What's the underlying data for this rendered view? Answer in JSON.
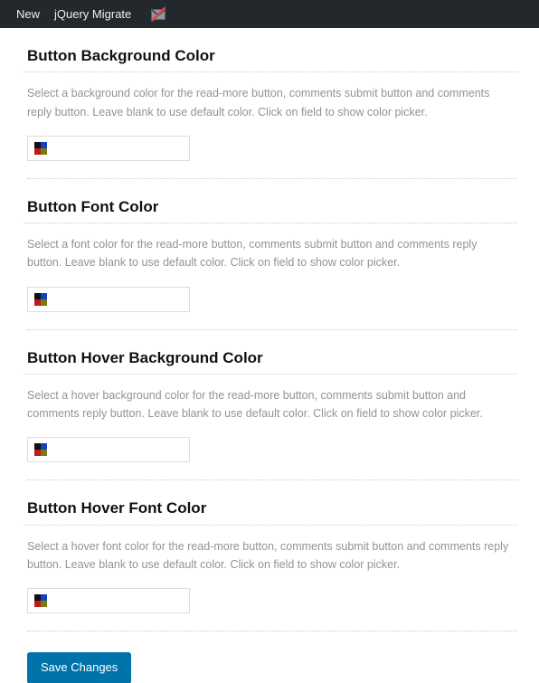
{
  "admin_bar": {
    "items": [
      {
        "label": "New",
        "name": "admin-bar-new"
      },
      {
        "label": "jQuery Migrate",
        "name": "admin-bar-jquery-migrate"
      }
    ],
    "icon": {
      "name": "mail-disabled-icon",
      "title": "",
      "envelope_color": "#8f959c",
      "strike_color": "#e04343"
    },
    "background": "#23282d",
    "text_color": "#eeeeee"
  },
  "sections": [
    {
      "title": "Button Background Color",
      "description": "Select a background color for the read-more button, comments submit button and comments reply button. Leave blank to use default color. Click on field to show color picker.",
      "field": {
        "name": "button-background-color-input",
        "value": "",
        "placeholder": "",
        "swatch": [
          "#111111",
          "#1a3fbd",
          "#c21a1a",
          "#7a7a12"
        ]
      }
    },
    {
      "title": "Button Font Color",
      "description": "Select a font color for the read-more button, comments submit button and comments reply button. Leave blank to use default color. Click on field to show color picker.",
      "field": {
        "name": "button-font-color-input",
        "value": "",
        "placeholder": "",
        "swatch": [
          "#111111",
          "#1a3fbd",
          "#c21a1a",
          "#7a7a12"
        ]
      }
    },
    {
      "title": "Button Hover Background Color",
      "description": "Select a hover background color for the read-more button, comments submit button and comments reply button. Leave blank to use default color. Click on field to show color picker.",
      "field": {
        "name": "button-hover-background-color-input",
        "value": "",
        "placeholder": "",
        "swatch": [
          "#111111",
          "#1a3fbd",
          "#c21a1a",
          "#7a7a12"
        ]
      }
    },
    {
      "title": "Button Hover Font Color",
      "description": "Select a hover font color for the read-more button, comments submit button and comments reply button. Leave blank to use default color. Click on field to show color picker.",
      "field": {
        "name": "button-hover-font-color-input",
        "value": "",
        "placeholder": "",
        "swatch": [
          "#111111",
          "#1a3fbd",
          "#c21a1a",
          "#7a7a12"
        ]
      }
    }
  ],
  "submit": {
    "label": "Save Changes",
    "accent": "#0073aa"
  }
}
